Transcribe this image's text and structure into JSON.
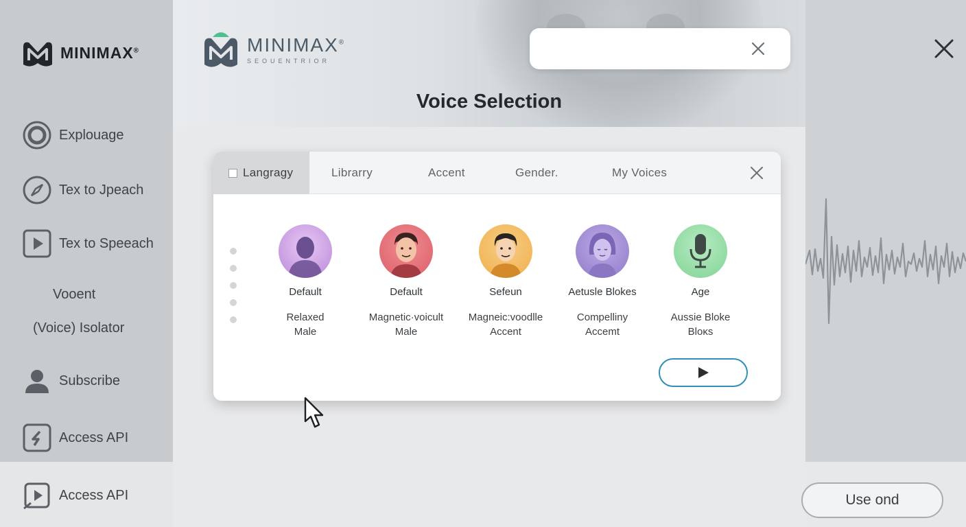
{
  "sidebar": {
    "logo_text": "MINIMAX",
    "logo_mark": "®",
    "items": [
      {
        "label": "Explouage",
        "icon": "target-icon"
      },
      {
        "label": "Tex to Jpeach",
        "icon": "compass-icon"
      },
      {
        "label": "Tex to Speeach",
        "icon": "play-square-icon"
      },
      {
        "label": "Vooent",
        "icon": ""
      },
      {
        "label": "(Voice) Isolator",
        "icon": ""
      },
      {
        "label": "Subscribe",
        "icon": "user-icon"
      },
      {
        "label": "Access API",
        "icon": "dollar-square-icon"
      },
      {
        "label": "Access API",
        "icon": "video-edit-icon"
      }
    ]
  },
  "header": {
    "brand_name": "MINIMAX",
    "brand_mark": "®",
    "brand_sub": "SEOUENTRIOR",
    "search_value": "",
    "title": "Voice Selection"
  },
  "dialog": {
    "tabs": [
      "Langragy",
      "Librarry",
      "Accent",
      "Gender.",
      "My Voices"
    ],
    "voices": [
      {
        "name": "Default",
        "desc_1": "Relaxed",
        "desc_2": "Male",
        "color": "#c79be0"
      },
      {
        "name": "Default",
        "desc_1": "Magnetic·voicult",
        "desc_2": "Male",
        "color": "#e06a72"
      },
      {
        "name": "Sefeun",
        "desc_1": "Magneic:voodlle",
        "desc_2": "Accent",
        "color": "#f2b65a"
      },
      {
        "name": "Aetusle Blokes",
        "desc_1": "Compelliny",
        "desc_2": "Accemt",
        "color": "#9b86cf"
      },
      {
        "name": "Age",
        "desc_1": "Aussie Bloke",
        "desc_2": "Bloĸs",
        "color": "#8fd9a0"
      }
    ]
  },
  "footer": {
    "use_label": "Use ond"
  },
  "colors": {
    "accent": "#2f8fb7",
    "sidebar_bg": "#c8cbce",
    "panel_bg": "#e8e9ea"
  }
}
